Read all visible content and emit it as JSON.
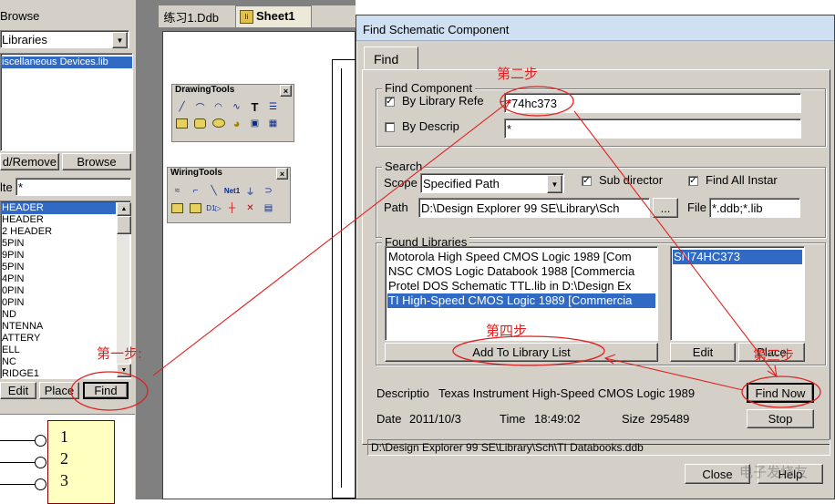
{
  "browse_panel": {
    "title": "Browse",
    "libraries_select": "Libraries",
    "library_item": "iscellaneous Devices.lib",
    "add_remove_label": "d/Remove",
    "browse_label": "Browse",
    "filter_label": "lte",
    "filter_value": "*",
    "components": [
      "HEADER",
      "HEADER",
      "2 HEADER",
      "5PIN",
      "9PIN",
      "5PIN",
      "4PIN",
      "0PIN",
      "0PIN",
      "ND",
      "NTENNA",
      "ATTERY",
      "ELL",
      "NC",
      "RIDGE1"
    ],
    "edit_label": "Edit",
    "place_label": "Place",
    "find_label": "Find",
    "pins": [
      "1",
      "2",
      "3"
    ]
  },
  "tabs": {
    "ddb": "练习1.Ddb",
    "sheet": "Sheet1"
  },
  "drawing_tools": {
    "title": "DrawingTools",
    "close": "×"
  },
  "wiring_tools": {
    "title": "WiringTools",
    "close": "×"
  },
  "dialog": {
    "title": "Find Schematic Component",
    "tab": "Find",
    "find_component": {
      "group_label": "Find Component",
      "by_library_ref_label": "By Library Refe",
      "by_library_ref_checked": "✓",
      "library_ref_value": "*74hc373",
      "by_description_label": "By Descrip",
      "description_value": "*"
    },
    "search": {
      "group_label": "Search",
      "scope_label": "Scope",
      "scope_value": "Specified Path",
      "sub_directories_label": "Sub director",
      "sub_directories_checked": "✓",
      "find_all_label": "Find All Instar",
      "find_all_checked": "✓",
      "path_label": "Path",
      "path_value": "D:\\Design Explorer 99 SE\\Library\\Sch",
      "browse_dots": "...",
      "file_label": "File",
      "file_value": "*.ddb;*.lib"
    },
    "found_libraries": {
      "group_label": "Found Libraries",
      "libraries": [
        "Motorola High Speed CMOS Logic 1989 [Com",
        "NSC CMOS Logic Databook 1988 [Commercia",
        "Protel DOS Schematic TTL.lib in D:\\Design Ex",
        "TI High-Speed CMOS Logic 1989 [Commercia"
      ],
      "selected_index": 3,
      "components": [
        "SN74HC373"
      ],
      "add_to_library_label": "Add To Library List",
      "edit_label": "Edit",
      "place_label": "Place"
    },
    "description_label": "Descriptio",
    "description_text": "Texas Instrument High-Speed CMOS Logic 1989",
    "find_now_label": "Find Now",
    "date_label": "Date",
    "date_value": "2011/10/3",
    "time_label": "Time",
    "time_value": "18:49:02",
    "size_label": "Size",
    "size_value": "295489",
    "stop_label": "Stop",
    "status_path": "D:\\Design Explorer 99 SE\\Library\\Sch\\TI Databooks.ddb",
    "close_label": "Close",
    "help_label": "Help"
  },
  "annotations": {
    "step1": "第一步:",
    "step2": "第二步",
    "step3": "第三步",
    "step4": "第四步"
  },
  "watermark": "电子发烧友",
  "colors": {
    "annotation": "#e02020",
    "selection": "#316ac5",
    "panel": "#d4d0c8"
  }
}
